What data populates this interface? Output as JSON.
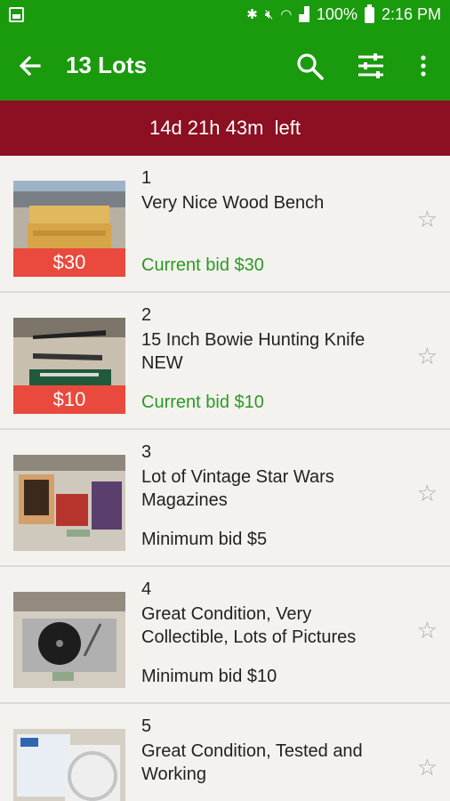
{
  "status_bar": {
    "battery": "100%",
    "time": "2:16 PM"
  },
  "app_bar": {
    "title": "13 Lots"
  },
  "banner": {
    "time_left": "14d 21h 43m  left"
  },
  "lots": [
    {
      "number": "1",
      "title": "Very Nice Wood Bench",
      "price_tag": "$30",
      "bid_text": "Current bid $30",
      "bid_type": "current"
    },
    {
      "number": "2",
      "title": "15 Inch Bowie Hunting Knife NEW",
      "price_tag": "$10",
      "bid_text": "Current bid $10",
      "bid_type": "current"
    },
    {
      "number": "3",
      "title": "Lot of Vintage Star Wars Magazines",
      "price_tag": "",
      "bid_text": "Minimum bid $5",
      "bid_type": "minimum"
    },
    {
      "number": "4",
      "title": "Great Condition, Very Collectible, Lots of Pictures",
      "price_tag": "",
      "bid_text": "Minimum bid $10",
      "bid_type": "minimum"
    },
    {
      "number": "5",
      "title": "Great Condition, Tested and Working",
      "price_tag": "",
      "bid_text": "",
      "bid_type": "minimum"
    }
  ],
  "colors": {
    "primary": "#1a9a0d",
    "banner": "#8c0f22",
    "price_tag": "#e94a3d",
    "current_bid": "#2a9a24"
  }
}
